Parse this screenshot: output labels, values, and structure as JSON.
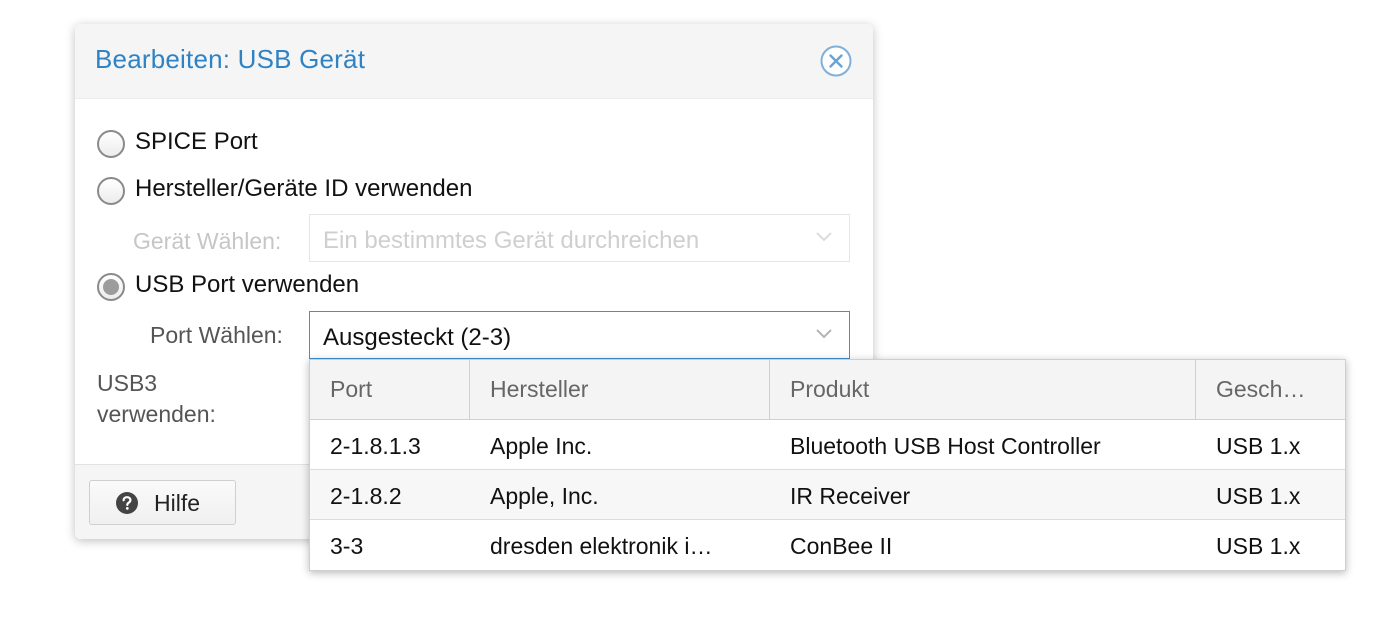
{
  "dialog": {
    "title": "Bearbeiten: USB Gerät",
    "close_icon": "close-circle-icon"
  },
  "options": {
    "spice": {
      "label": "SPICE Port",
      "checked": false
    },
    "vendor": {
      "label": "Hersteller/Geräte ID verwenden",
      "checked": false
    },
    "device_select": {
      "label": "Gerät Wählen:",
      "placeholder": "Ein bestimmtes Gerät durchreichen",
      "disabled": true
    },
    "usbport": {
      "label": "USB Port verwenden",
      "checked": true
    },
    "port_select": {
      "label": "Port Wählen:",
      "value": "Ausgesteckt (2-3)"
    },
    "usb3": {
      "label": "USB3 verwenden:"
    }
  },
  "grid": {
    "columns": [
      "Port",
      "Hersteller",
      "Produkt",
      "Gesch…"
    ],
    "rows": [
      [
        "2-1.8.1.3",
        "Apple Inc.",
        "Bluetooth USB Host Controller",
        "USB 1.x"
      ],
      [
        "2-1.8.2",
        "Apple, Inc.",
        "IR Receiver",
        "USB 1.x"
      ],
      [
        "3-3",
        "dresden elektronik i…",
        "ConBee II",
        "USB 1.x"
      ]
    ]
  },
  "footer": {
    "help_label": "Hilfe",
    "help_icon": "question-circle-icon"
  },
  "colors": {
    "title_blue": "#2f83c4",
    "focus_border": "#3d92d3"
  }
}
